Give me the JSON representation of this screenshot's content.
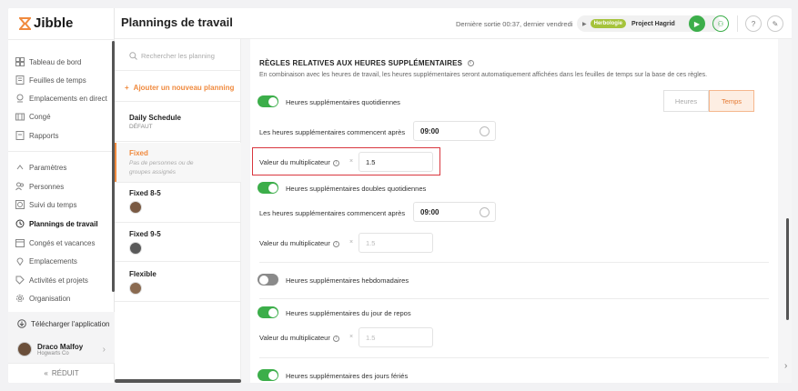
{
  "app": {
    "logo_text": "Jibble"
  },
  "sidebar": {
    "items": [
      {
        "label": "Tableau de bord",
        "icon": "dashboard-icon"
      },
      {
        "label": "Feuilles de temps",
        "icon": "timesheet-icon"
      },
      {
        "label": "Emplacements en direct",
        "icon": "location-icon"
      },
      {
        "label": "Congé",
        "icon": "leave-icon"
      },
      {
        "label": "Rapports",
        "icon": "reports-icon"
      },
      {
        "label": "Paramètres",
        "icon": "chevron-up-icon"
      },
      {
        "label": "Personnes",
        "icon": "people-icon"
      },
      {
        "label": "Suivi du temps",
        "icon": "time-tracking-icon"
      },
      {
        "label": "Plannings de travail",
        "icon": "schedule-icon"
      },
      {
        "label": "Congés et vacances",
        "icon": "holiday-icon"
      },
      {
        "label": "Emplacements",
        "icon": "pin-icon"
      },
      {
        "label": "Activités et projets",
        "icon": "tag-icon"
      },
      {
        "label": "Organisation",
        "icon": "gear-icon"
      }
    ],
    "download_label": "Télécharger l'application",
    "user_name": "Draco Malfoy",
    "user_org": "Hogwarts Co",
    "collapse_label": "RÉDUIT"
  },
  "header": {
    "title": "Plannings de travail",
    "last_out": "Dernière sortie 00:37, dernier vendredi",
    "activity_badge": "Herbologie",
    "project": "Project Hagrid"
  },
  "schedules": {
    "search_placeholder": "Rechercher les planning",
    "add_label": "Ajouter un nouveau planning",
    "items": [
      {
        "title": "Daily Schedule",
        "subtitle": "DÉFAUT"
      },
      {
        "title": "Fixed",
        "subtitle": "Pas de personnes ou de groupes assignés"
      },
      {
        "title": "Fixed 8-5",
        "subtitle": ""
      },
      {
        "title": "Fixed 9-5",
        "subtitle": ""
      },
      {
        "title": "Flexible",
        "subtitle": ""
      }
    ]
  },
  "overtime": {
    "section_title": "RÈGLES RELATIVES AUX HEURES SUPPLÉMENTAIRES",
    "section_desc": "En combinaison avec les heures de travail, les heures supplémentaires seront automatiquement affichées dans les feuilles de temps sur la base de ces règles.",
    "seg_hours": "Heures",
    "seg_time": "Temps",
    "daily_label": "Heures supplémentaires quotidiennes",
    "starts_after_label": "Les heures supplémentaires commencent après",
    "daily_start": "09:00",
    "multiplier_label": "Valeur du multiplicateur",
    "x_symbol": "×",
    "daily_multiplier": "1.5",
    "double_daily_label": "Heures supplémentaires doubles quotidiennes",
    "double_start": "09:00",
    "double_multiplier_placeholder": "1.5",
    "weekly_label": "Heures supplémentaires hebdomadaires",
    "rest_day_label": "Heures supplémentaires du jour de repos",
    "rest_multiplier_placeholder": "1.5",
    "holiday_label": "Heures supplémentaires des jours fériés"
  }
}
